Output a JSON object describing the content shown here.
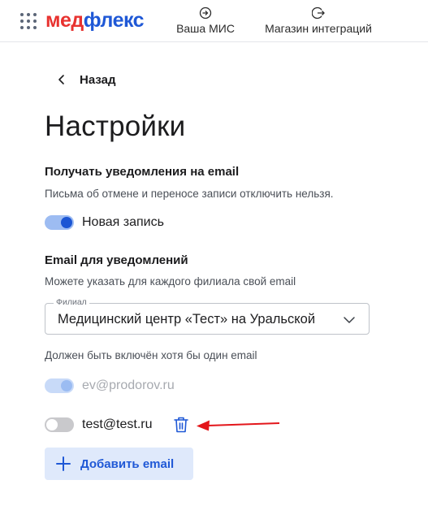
{
  "header": {
    "logo_part1": "мед",
    "logo_part2": "флекс",
    "nav": [
      {
        "label": "Ваша МИС",
        "icon": "login-icon"
      },
      {
        "label": "Магазин интеграций",
        "icon": "logout-icon"
      }
    ]
  },
  "back_label": "Назад",
  "page_title": "Настройки",
  "notifications": {
    "title": "Получать уведомления на email",
    "description": "Письма об отмене и переносе записи отключить нельзя.",
    "toggle_label": "Новая запись",
    "toggle_on": true
  },
  "emails": {
    "title": "Email для уведомлений",
    "description": "Можете указать для каждого филиала свой email",
    "branch_legend": "Филиал",
    "branch_value": "Медицинский центр «Тест» на Уральской",
    "hint": "Должен быть включён хотя бы один email",
    "items": [
      {
        "email": "ev@prodorov.ru",
        "state": "on-disabled"
      },
      {
        "email": "test@test.ru",
        "state": "off",
        "deletable": true
      }
    ],
    "add_label": "Добавить email"
  },
  "colors": {
    "brand_red": "#e8322f",
    "brand_blue": "#1f58d6",
    "annotation_arrow": "#e3161b"
  }
}
